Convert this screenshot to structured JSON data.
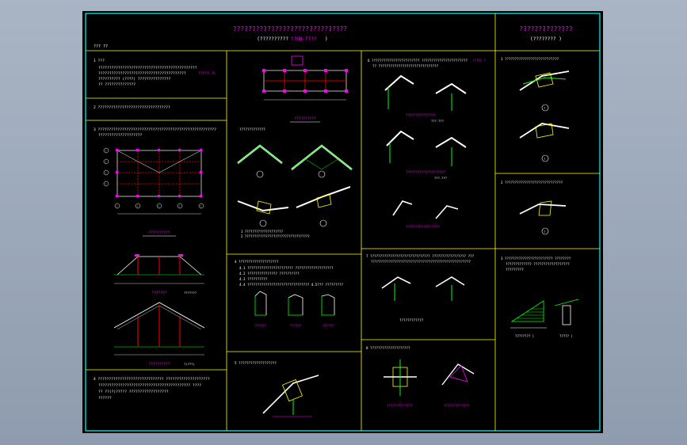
{
  "title": {
    "main": "??????????????????????????????",
    "sub_left": "(??????????",
    "sub_mid": "??GB-????",
    "sub_right": ")"
  },
  "right_header": {
    "main": "??????????????",
    "sub": "(???????? )"
  },
  "colors": {
    "sheet_bg": "#000000",
    "border": "#00ffff",
    "frame": "#ffff00",
    "lines": "#ffffff",
    "steel": "#00ff00",
    "highlight": "#ff00ff",
    "columns": "#ff0000"
  },
  "left_col": {
    "tag": "??? ??",
    "s1_num": "1 ???",
    "s1_lines": [
      "?????????????????????????????????????????????",
      "????????????????????????????????????????",
      "?????????? (????) ???????????????",
      "?? ??????????????"
    ],
    "s1_mark": "?????-?)",
    "s2": "2 ?????????????????????????????????",
    "s3_lines": [
      "3 ??????????????????????????????????????????????????????",
      "????????????????????"
    ],
    "plan_caption": "??????????",
    "elev1_caption": "???????",
    "elev1_ratio": "???????",
    "elev2_caption": "??????????",
    "elev2_ratio": "?(???)",
    "s4_lines": [
      "4 ??????????????????????????????  ????????????????????",
      "??????????????????????????????????????????  ????",
      "?? ??(?)????? ??????????????????",
      "??????"
    ]
  },
  "col2": {
    "plan_caption": "??????????",
    "mid_text": "?????????????",
    "notes": [
      "1 ????????????????????",
      "2 ??????????????????????????????????"
    ],
    "s4_header": "4 ????????????????????",
    "s4_lines": [
      "4.1 ??????????????????????? ???????????????????",
      "4.2 ??????????????? ??????????",
      "4.3 ??????????",
      "4.4 ???????????????????????????????   4.5??? ?????????"
    ],
    "d_captions": [
      "??????",
      "??????",
      "??????"
    ],
    "s5_header": "5 ???????????????????"
  },
  "col3": {
    "s6_header": "6 ????????????????????????   ???????????????????????",
    "s6_sub": "?? ??????????????????????????????",
    "s6_mark": "(???)-?",
    "caption1": "???????????????",
    "caption1_mark": "???-???",
    "caption2": "????????????????????",
    "caption2_mark": "???-???",
    "caption3": "?????????????????",
    "s7_header": "7 ??????????????????????????????    ????????????????? ???",
    "s7_sub": "??????????????????????????????????????????????????",
    "s7_note": "????????????",
    "s8_header": "8 ????????????????????",
    "cap_a": "?????????????",
    "cap_b": "?????????????"
  },
  "col4": {
    "s1_header": "1 ???????????????????????????",
    "s2_header": "2 ?????????????????????????????",
    "s3_lines": [
      "3 ????????????????????????  ????????",
      "????????????? ??????????????????",
      "?????????"
    ],
    "cap1": "????????  )",
    "cap2": "????? )",
    "labels": [
      "?",
      "?",
      "?"
    ]
  },
  "grid_labels": {
    "plan_rows": [
      "?",
      "?",
      "?",
      "?"
    ],
    "plan_cols": [
      "?",
      "?",
      "?",
      "?",
      "?"
    ]
  }
}
